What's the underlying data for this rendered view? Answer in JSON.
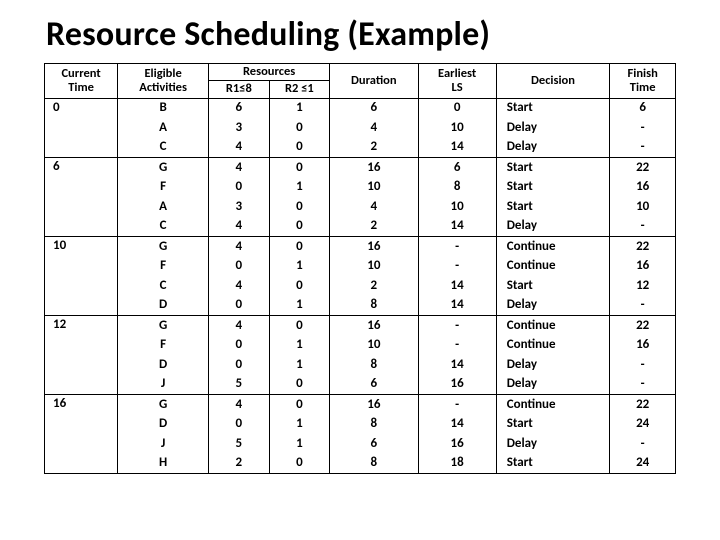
{
  "title": "Resource Scheduling (Example)",
  "headers": {
    "current_time": "Current\nTime",
    "eligible": "Eligible\nActivities",
    "resources": "Resources",
    "r1": "R1≤8",
    "r2": "R2 ≤1",
    "duration": "Duration",
    "earliest_ls": "Earliest\nLS",
    "decision": "Decision",
    "finish": "Finish\nTime"
  },
  "groups": [
    {
      "time": "0",
      "rows": [
        {
          "act": "B",
          "r1": "6",
          "r2": "1",
          "dur": "6",
          "ls": "0",
          "dec": "Start",
          "fin": "6"
        },
        {
          "act": "A",
          "r1": "3",
          "r2": "0",
          "dur": "4",
          "ls": "10",
          "dec": "Delay",
          "fin": "-"
        },
        {
          "act": "C",
          "r1": "4",
          "r2": "0",
          "dur": "2",
          "ls": "14",
          "dec": "Delay",
          "fin": "-"
        }
      ]
    },
    {
      "time": "6",
      "rows": [
        {
          "act": "G",
          "r1": "4",
          "r2": "0",
          "dur": "16",
          "ls": "6",
          "dec": "Start",
          "fin": "22"
        },
        {
          "act": "F",
          "r1": "0",
          "r2": "1",
          "dur": "10",
          "ls": "8",
          "dec": "Start",
          "fin": "16"
        },
        {
          "act": "A",
          "r1": "3",
          "r2": "0",
          "dur": "4",
          "ls": "10",
          "dec": "Start",
          "fin": "10"
        },
        {
          "act": "C",
          "r1": "4",
          "r2": "0",
          "dur": "2",
          "ls": "14",
          "dec": "Delay",
          "fin": "-"
        }
      ]
    },
    {
      "time": "10",
      "rows": [
        {
          "act": "G",
          "r1": "4",
          "r2": "0",
          "dur": "16",
          "ls": "-",
          "dec": "Continue",
          "fin": "22"
        },
        {
          "act": "F",
          "r1": "0",
          "r2": "1",
          "dur": "10",
          "ls": "-",
          "dec": "Continue",
          "fin": "16"
        },
        {
          "act": "C",
          "r1": "4",
          "r2": "0",
          "dur": "2",
          "ls": "14",
          "dec": "Start",
          "fin": "12"
        },
        {
          "act": "D",
          "r1": "0",
          "r2": "1",
          "dur": "8",
          "ls": "14",
          "dec": "Delay",
          "fin": "-"
        }
      ]
    },
    {
      "time": "12",
      "rows": [
        {
          "act": "G",
          "r1": "4",
          "r2": "0",
          "dur": "16",
          "ls": "-",
          "dec": "Continue",
          "fin": "22"
        },
        {
          "act": "F",
          "r1": "0",
          "r2": "1",
          "dur": "10",
          "ls": "-",
          "dec": "Continue",
          "fin": "16"
        },
        {
          "act": "D",
          "r1": "0",
          "r2": "1",
          "dur": "8",
          "ls": "14",
          "dec": "Delay",
          "fin": "-"
        },
        {
          "act": "J",
          "r1": "5",
          "r2": "0",
          "dur": "6",
          "ls": "16",
          "dec": "Delay",
          "fin": "-"
        }
      ]
    },
    {
      "time": "16",
      "rows": [
        {
          "act": "G",
          "r1": "4",
          "r2": "0",
          "dur": "16",
          "ls": "-",
          "dec": "Continue",
          "fin": "22"
        },
        {
          "act": "D",
          "r1": "0",
          "r2": "1",
          "dur": "8",
          "ls": "14",
          "dec": "Start",
          "fin": "24"
        },
        {
          "act": "J",
          "r1": "5",
          "r2": "1",
          "dur": "6",
          "ls": "16",
          "dec": "Delay",
          "fin": "-"
        },
        {
          "act": "H",
          "r1": "2",
          "r2": "0",
          "dur": "8",
          "ls": "18",
          "dec": "Start",
          "fin": "24"
        }
      ]
    }
  ]
}
